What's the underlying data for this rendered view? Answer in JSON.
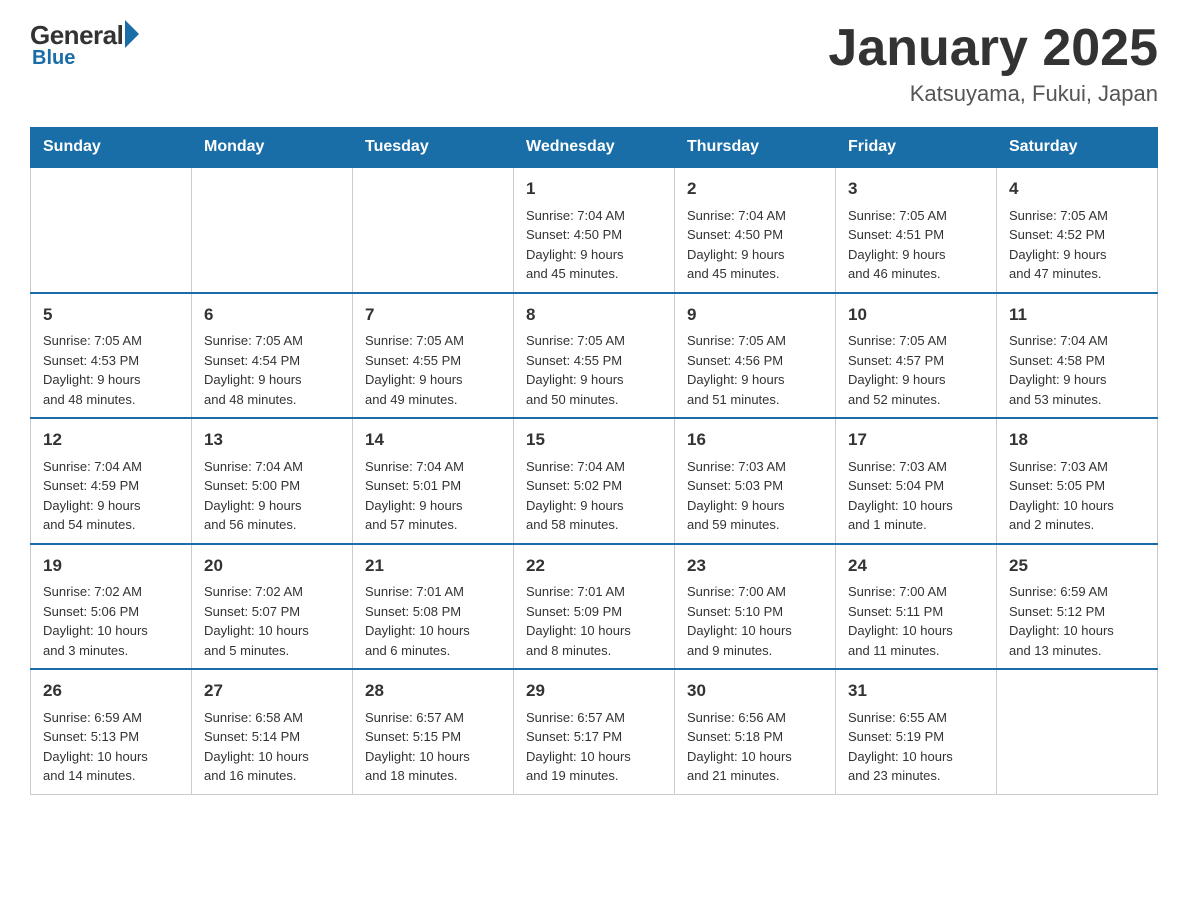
{
  "logo": {
    "general": "General",
    "blue": "Blue"
  },
  "title": "January 2025",
  "location": "Katsuyama, Fukui, Japan",
  "days_of_week": [
    "Sunday",
    "Monday",
    "Tuesday",
    "Wednesday",
    "Thursday",
    "Friday",
    "Saturday"
  ],
  "weeks": [
    [
      {
        "day": "",
        "info": ""
      },
      {
        "day": "",
        "info": ""
      },
      {
        "day": "",
        "info": ""
      },
      {
        "day": "1",
        "info": "Sunrise: 7:04 AM\nSunset: 4:50 PM\nDaylight: 9 hours\nand 45 minutes."
      },
      {
        "day": "2",
        "info": "Sunrise: 7:04 AM\nSunset: 4:50 PM\nDaylight: 9 hours\nand 45 minutes."
      },
      {
        "day": "3",
        "info": "Sunrise: 7:05 AM\nSunset: 4:51 PM\nDaylight: 9 hours\nand 46 minutes."
      },
      {
        "day": "4",
        "info": "Sunrise: 7:05 AM\nSunset: 4:52 PM\nDaylight: 9 hours\nand 47 minutes."
      }
    ],
    [
      {
        "day": "5",
        "info": "Sunrise: 7:05 AM\nSunset: 4:53 PM\nDaylight: 9 hours\nand 48 minutes."
      },
      {
        "day": "6",
        "info": "Sunrise: 7:05 AM\nSunset: 4:54 PM\nDaylight: 9 hours\nand 48 minutes."
      },
      {
        "day": "7",
        "info": "Sunrise: 7:05 AM\nSunset: 4:55 PM\nDaylight: 9 hours\nand 49 minutes."
      },
      {
        "day": "8",
        "info": "Sunrise: 7:05 AM\nSunset: 4:55 PM\nDaylight: 9 hours\nand 50 minutes."
      },
      {
        "day": "9",
        "info": "Sunrise: 7:05 AM\nSunset: 4:56 PM\nDaylight: 9 hours\nand 51 minutes."
      },
      {
        "day": "10",
        "info": "Sunrise: 7:05 AM\nSunset: 4:57 PM\nDaylight: 9 hours\nand 52 minutes."
      },
      {
        "day": "11",
        "info": "Sunrise: 7:04 AM\nSunset: 4:58 PM\nDaylight: 9 hours\nand 53 minutes."
      }
    ],
    [
      {
        "day": "12",
        "info": "Sunrise: 7:04 AM\nSunset: 4:59 PM\nDaylight: 9 hours\nand 54 minutes."
      },
      {
        "day": "13",
        "info": "Sunrise: 7:04 AM\nSunset: 5:00 PM\nDaylight: 9 hours\nand 56 minutes."
      },
      {
        "day": "14",
        "info": "Sunrise: 7:04 AM\nSunset: 5:01 PM\nDaylight: 9 hours\nand 57 minutes."
      },
      {
        "day": "15",
        "info": "Sunrise: 7:04 AM\nSunset: 5:02 PM\nDaylight: 9 hours\nand 58 minutes."
      },
      {
        "day": "16",
        "info": "Sunrise: 7:03 AM\nSunset: 5:03 PM\nDaylight: 9 hours\nand 59 minutes."
      },
      {
        "day": "17",
        "info": "Sunrise: 7:03 AM\nSunset: 5:04 PM\nDaylight: 10 hours\nand 1 minute."
      },
      {
        "day": "18",
        "info": "Sunrise: 7:03 AM\nSunset: 5:05 PM\nDaylight: 10 hours\nand 2 minutes."
      }
    ],
    [
      {
        "day": "19",
        "info": "Sunrise: 7:02 AM\nSunset: 5:06 PM\nDaylight: 10 hours\nand 3 minutes."
      },
      {
        "day": "20",
        "info": "Sunrise: 7:02 AM\nSunset: 5:07 PM\nDaylight: 10 hours\nand 5 minutes."
      },
      {
        "day": "21",
        "info": "Sunrise: 7:01 AM\nSunset: 5:08 PM\nDaylight: 10 hours\nand 6 minutes."
      },
      {
        "day": "22",
        "info": "Sunrise: 7:01 AM\nSunset: 5:09 PM\nDaylight: 10 hours\nand 8 minutes."
      },
      {
        "day": "23",
        "info": "Sunrise: 7:00 AM\nSunset: 5:10 PM\nDaylight: 10 hours\nand 9 minutes."
      },
      {
        "day": "24",
        "info": "Sunrise: 7:00 AM\nSunset: 5:11 PM\nDaylight: 10 hours\nand 11 minutes."
      },
      {
        "day": "25",
        "info": "Sunrise: 6:59 AM\nSunset: 5:12 PM\nDaylight: 10 hours\nand 13 minutes."
      }
    ],
    [
      {
        "day": "26",
        "info": "Sunrise: 6:59 AM\nSunset: 5:13 PM\nDaylight: 10 hours\nand 14 minutes."
      },
      {
        "day": "27",
        "info": "Sunrise: 6:58 AM\nSunset: 5:14 PM\nDaylight: 10 hours\nand 16 minutes."
      },
      {
        "day": "28",
        "info": "Sunrise: 6:57 AM\nSunset: 5:15 PM\nDaylight: 10 hours\nand 18 minutes."
      },
      {
        "day": "29",
        "info": "Sunrise: 6:57 AM\nSunset: 5:17 PM\nDaylight: 10 hours\nand 19 minutes."
      },
      {
        "day": "30",
        "info": "Sunrise: 6:56 AM\nSunset: 5:18 PM\nDaylight: 10 hours\nand 21 minutes."
      },
      {
        "day": "31",
        "info": "Sunrise: 6:55 AM\nSunset: 5:19 PM\nDaylight: 10 hours\nand 23 minutes."
      },
      {
        "day": "",
        "info": ""
      }
    ]
  ]
}
